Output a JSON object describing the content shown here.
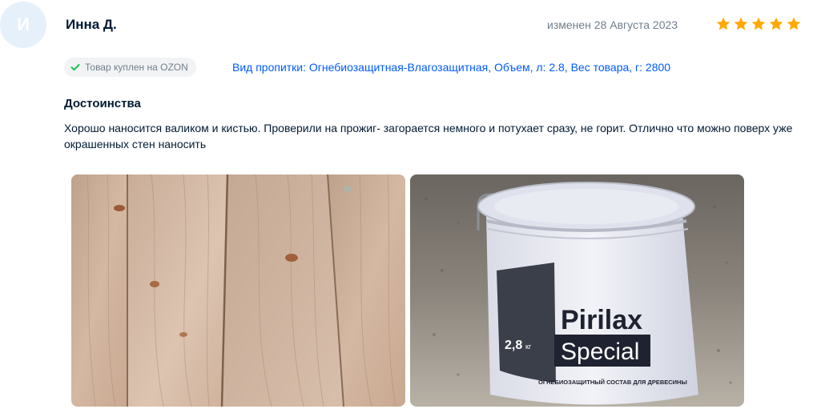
{
  "review": {
    "avatar_letter": "И",
    "author": "Инна Д.",
    "date": "изменен 28 Августа 2023",
    "rating": 5,
    "purchase_badge": "Товар куплен на OZON",
    "variant": "Вид пропитки: Огнебиозащитная-Влагозащитная, Объем, л: 2.8, Вес товара, г: 2800",
    "section_title": "Достоинства",
    "text": "Хорошо наносится валиком и кистью. Проверили на прожиг- загорается немного и потухает сразу, не горит. Отлично что можно поверх уже окрашенных стен наносить"
  },
  "product_label": {
    "brand_line1": "Pirilax",
    "brand_line2": "Special",
    "volume": "2,8",
    "volume_unit": "кг",
    "bottom_text": "ОГНЕБИОЗАЩИТНЫЙ СОСТАВ ДЛЯ ДРЕВЕСИНЫ"
  },
  "colors": {
    "star": "#ffa800",
    "link": "#005bff",
    "check": "#10c44c"
  },
  "icons": [
    "star-icon",
    "check-icon"
  ]
}
